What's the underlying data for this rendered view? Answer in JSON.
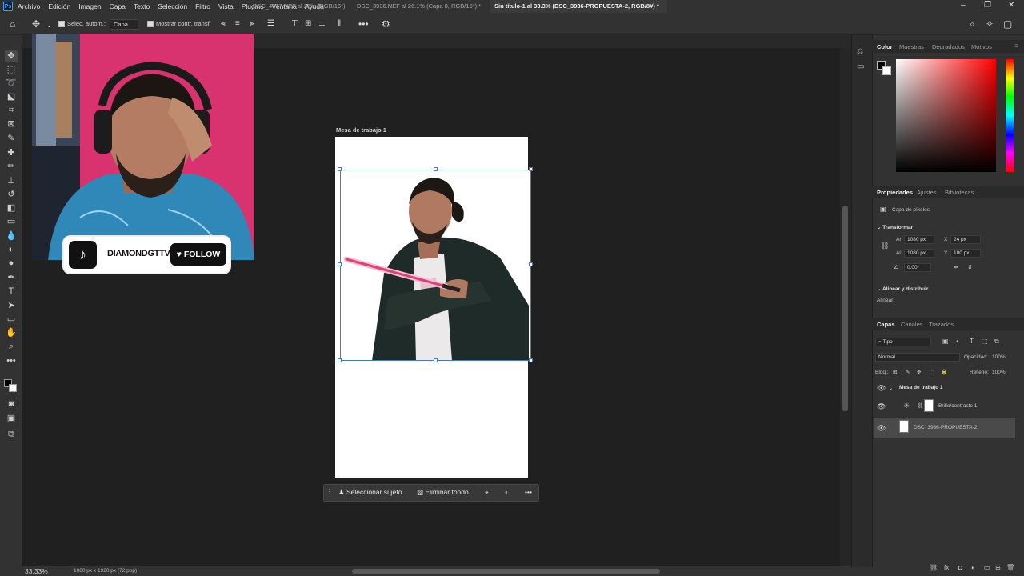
{
  "menubar": {
    "logo": "Ps",
    "items": [
      "Archivo",
      "Edición",
      "Imagen",
      "Capa",
      "Texto",
      "Selección",
      "Filtro",
      "Vista",
      "Plugins",
      "Ventana",
      "Ayuda"
    ]
  },
  "options": {
    "auto_select_label": "Selec. autom.:",
    "auto_select_value": "Capa",
    "show_transform_label": "Mostrar contr. transf."
  },
  "tabs": [
    {
      "label": "DSC_4017.NEF al 25% (RGB/16*)"
    },
    {
      "label": "DSC_3936.NEF al 26.1% (Capa 0, RGB/16*) *"
    },
    {
      "label": "Sin título-1 al 33.3% (DSC_3936-PROPUESTA-2, RGB/8#) *"
    }
  ],
  "canvas": {
    "artboard_label": "Mesa de trabajo 1"
  },
  "overlay": {
    "tiktok_handle": "DIAMONDGTTV",
    "follow_label": "FOLLOW"
  },
  "taskbar": {
    "select_subject": "Seleccionar sujeto",
    "remove_bg": "Eliminar fondo"
  },
  "status": {
    "zoom": "33.33%",
    "doc_info": "1080 px x 1920 px (72 ppp)"
  },
  "color_panel": {
    "tabs": [
      "Color",
      "Muestras",
      "Degradados",
      "Motivos"
    ]
  },
  "properties_panel": {
    "tabs": [
      "Propiedades",
      "Ajustes",
      "Bibliotecas"
    ],
    "layer_type": "Capa de píxeles",
    "transform_title": "Transformar",
    "w_label": "An",
    "w_value": "1080 px",
    "h_label": "Al",
    "h_value": "1080 px",
    "x_label": "X",
    "x_value": "24 px",
    "y_label": "Y",
    "y_value": "180 px",
    "angle_value": "0.00°",
    "align_title": "Alinear y distribuir",
    "align_label": "Alinear:"
  },
  "layers_panel": {
    "tabs": [
      "Capas",
      "Canales",
      "Trazados"
    ],
    "filter_label": "Tipo",
    "blend_mode": "Normal",
    "opacity_label": "Opacidad:",
    "opacity_value": "100%",
    "lock_label": "Bloq.:",
    "fill_label": "Relleno:",
    "fill_value": "100%",
    "layers": [
      {
        "name": "Mesa de trabajo 1"
      },
      {
        "name": "Brillo/contraste 1"
      },
      {
        "name": "DSC_3936-PROPUESTA-2"
      }
    ]
  }
}
